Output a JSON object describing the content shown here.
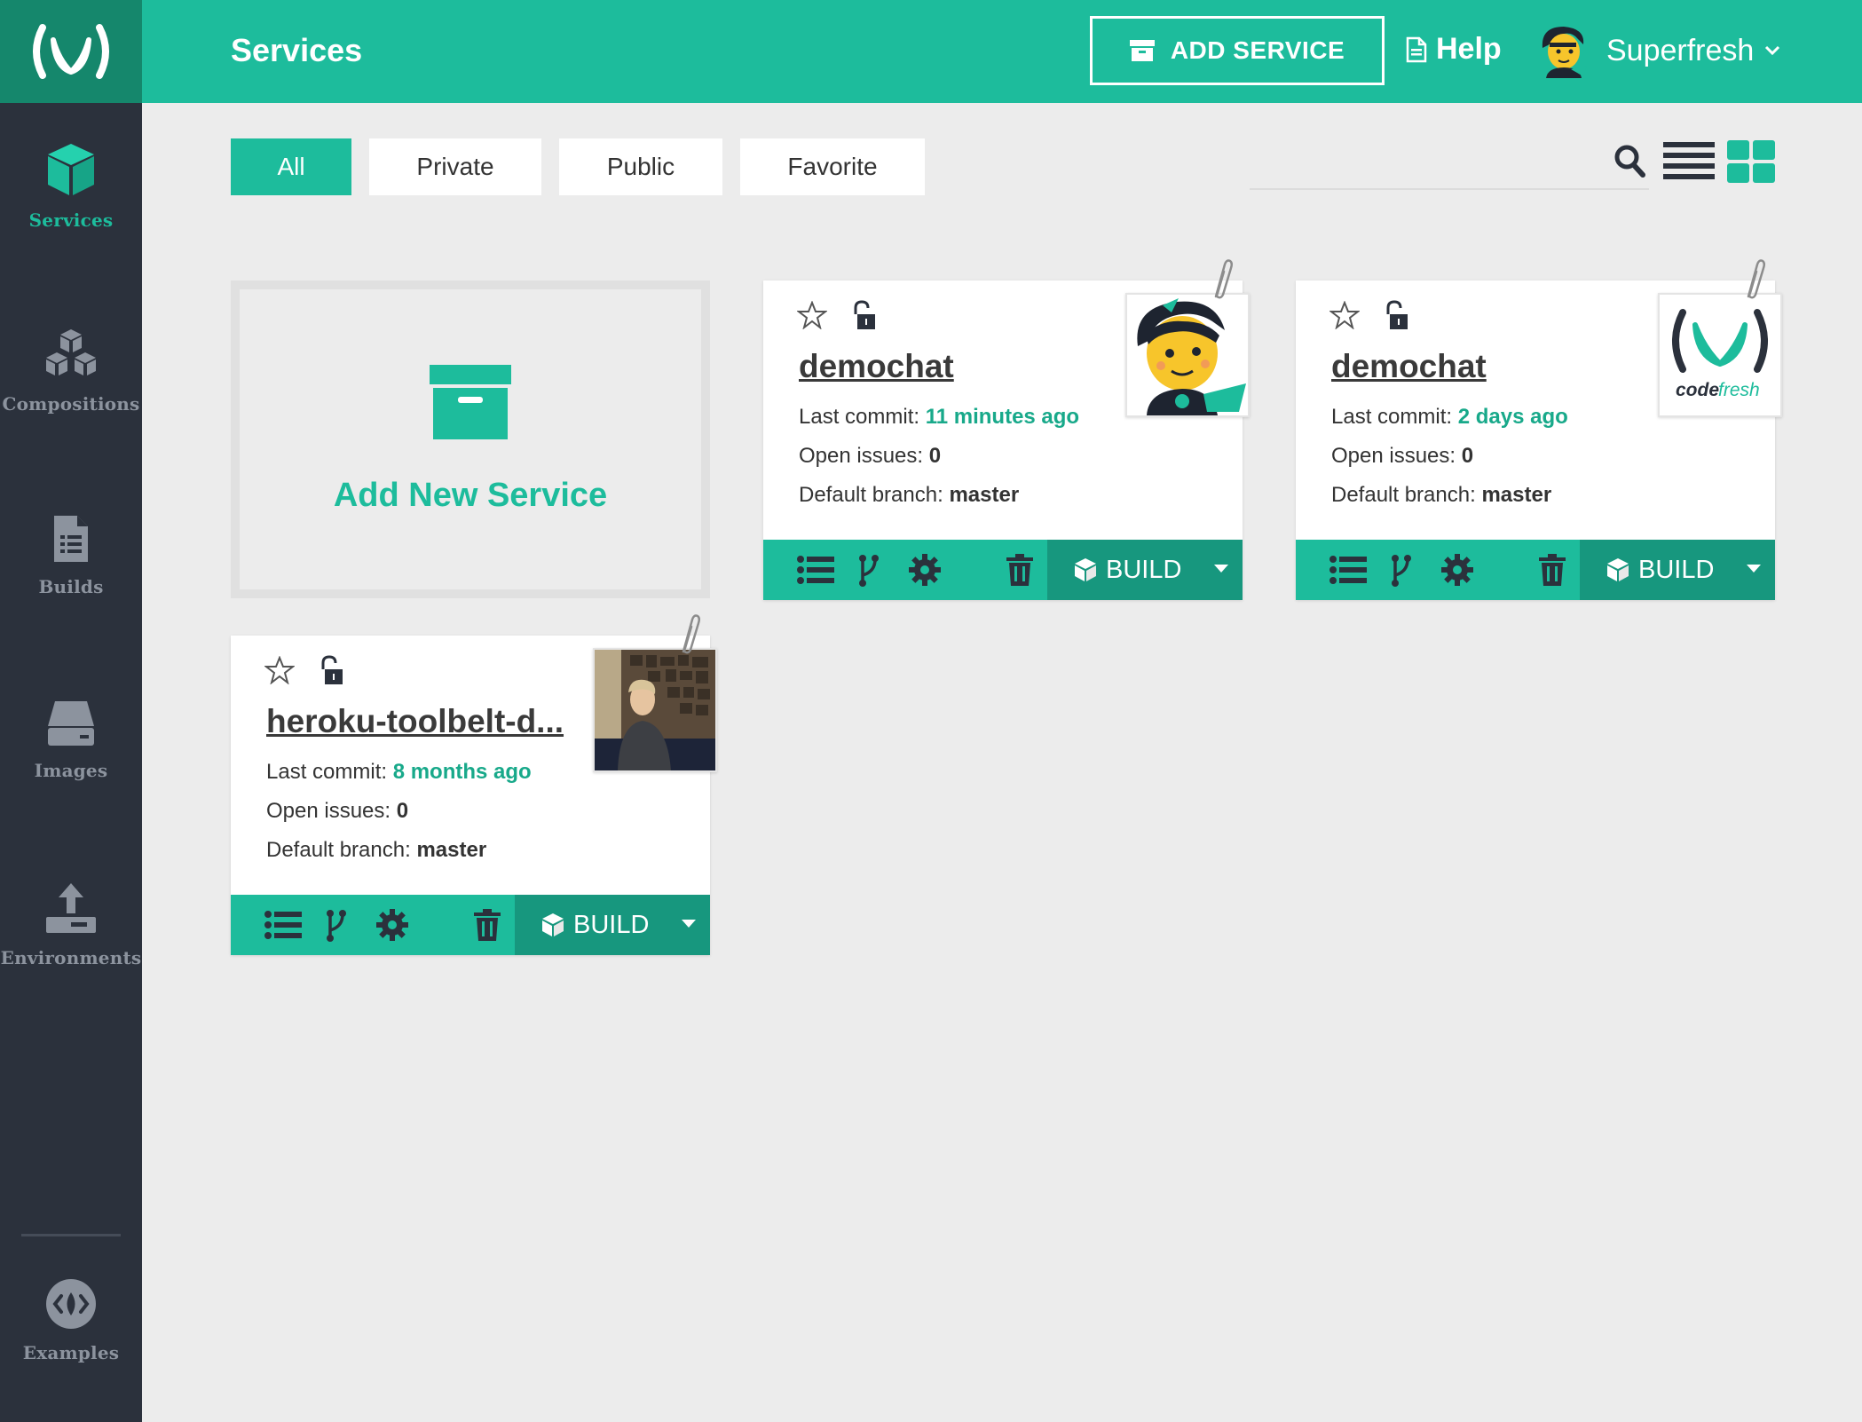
{
  "app": {
    "title": "Services",
    "brand_color": "#1dbc9c",
    "sidebar_color": "#2b313c"
  },
  "header": {
    "add_service_label": "ADD SERVICE",
    "help_label": "Help",
    "user_name": "Superfresh"
  },
  "sidebar": {
    "items": [
      {
        "label": "Services",
        "icon": "cube-icon",
        "active": true
      },
      {
        "label": "Compositions",
        "icon": "cubes-icon",
        "active": false
      },
      {
        "label": "Builds",
        "icon": "document-icon",
        "active": false
      },
      {
        "label": "Images",
        "icon": "drive-icon",
        "active": false
      },
      {
        "label": "Environments",
        "icon": "upload-icon",
        "active": false
      },
      {
        "label": "Examples",
        "icon": "code-leaf-icon",
        "active": false
      }
    ]
  },
  "filters": {
    "tabs": [
      "All",
      "Private",
      "Public",
      "Favorite"
    ],
    "active": "All",
    "search_value": ""
  },
  "add_card": {
    "label": "Add New Service"
  },
  "services": [
    {
      "name": "demochat",
      "last_commit_label": "Last commit:",
      "last_commit": "11 minutes ago",
      "open_issues_label": "Open issues:",
      "open_issues": "0",
      "branch_label": "Default branch:",
      "branch": "master",
      "build_label": "BUILD",
      "thumb": "mascot"
    },
    {
      "name": "demochat",
      "last_commit_label": "Last commit:",
      "last_commit": "2 days ago",
      "open_issues_label": "Open issues:",
      "open_issues": "0",
      "branch_label": "Default branch:",
      "branch": "master",
      "build_label": "BUILD",
      "thumb": "codefresh-logo"
    },
    {
      "name": "heroku-toolbelt-d...",
      "last_commit_label": "Last commit:",
      "last_commit": "8 months ago",
      "open_issues_label": "Open issues:",
      "open_issues": "0",
      "branch_label": "Default branch:",
      "branch": "master",
      "build_label": "BUILD",
      "thumb": "photo"
    }
  ],
  "logo_text": {
    "code": "code",
    "fresh": "fresh"
  }
}
